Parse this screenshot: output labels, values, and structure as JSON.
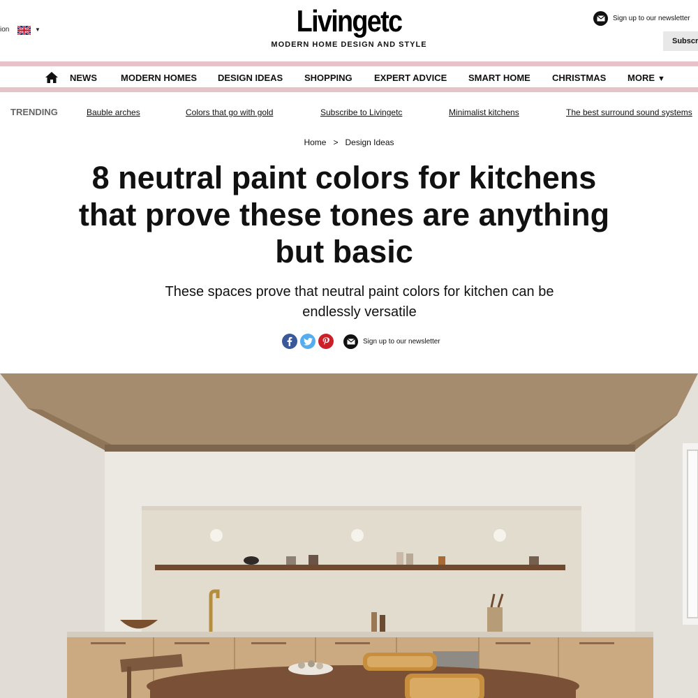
{
  "header": {
    "edition_label": "ion",
    "logo": "Livingetc",
    "tagline": "MODERN HOME DESIGN AND STYLE",
    "newsletter_label": "Sign up to our newsletter",
    "subscribe_label": "Subscr"
  },
  "nav": {
    "items": [
      "NEWS",
      "MODERN HOMES",
      "DESIGN IDEAS",
      "SHOPPING",
      "EXPERT ADVICE",
      "SMART HOME",
      "CHRISTMAS",
      "MORE"
    ],
    "more_caret": "▼"
  },
  "trending": {
    "label": "TRENDING",
    "links": [
      "Bauble arches",
      "Colors that go with gold",
      "Subscribe to Livingetc",
      "Minimalist kitchens",
      "The best surround sound systems"
    ]
  },
  "breadcrumb": {
    "home": "Home",
    "separator": ">",
    "section": "Design Ideas"
  },
  "article": {
    "headline": "8 neutral paint colors for kitchens that prove these tones are anything but basic",
    "standfirst": "These spaces prove that neutral paint colors for kitchen can be endlessly versatile",
    "share_newsletter_label": "Sign up to our newsletter"
  },
  "icons": {
    "home": "home-icon",
    "flag": "uk-flag-icon",
    "newsletter": "envelope-icon",
    "facebook": "facebook-icon",
    "twitter": "twitter-icon",
    "pinterest": "pinterest-icon"
  },
  "colors": {
    "nav_accent": "#e6c3c9",
    "facebook": "#3b5998",
    "twitter": "#55acee",
    "pinterest": "#cb2027"
  }
}
